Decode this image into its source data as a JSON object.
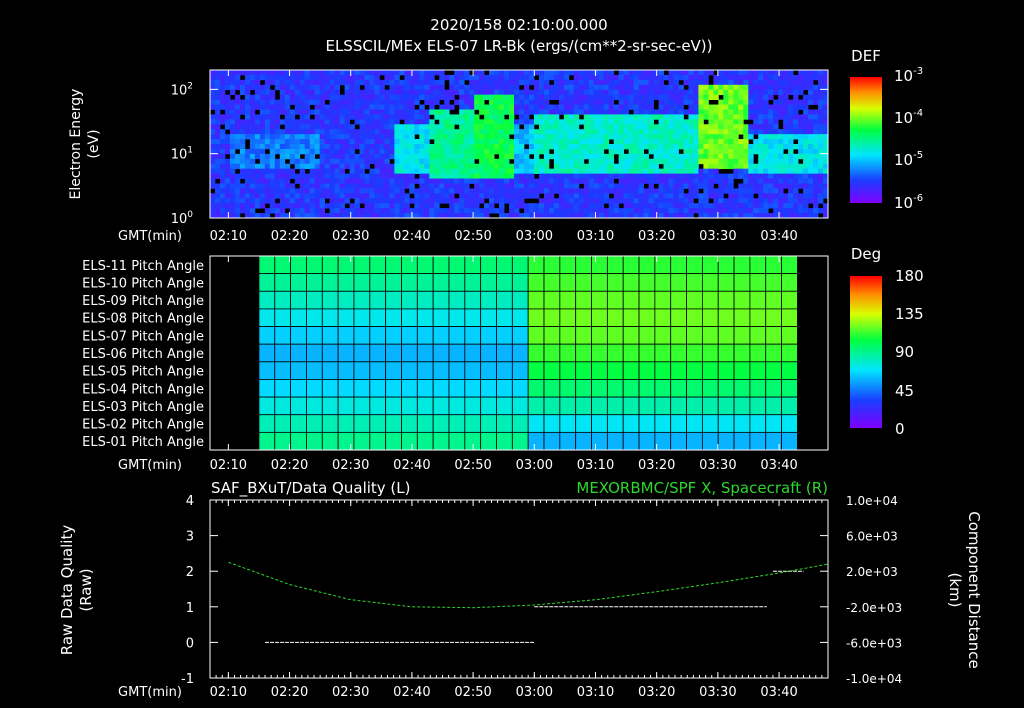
{
  "header": {
    "timestamp": "2020/158 02:10:00.000",
    "subtitle": "ELSSCIL/MEx ELS-07 LR-Bk  (ergs/(cm**2-sr-sec-eV))"
  },
  "colors": {
    "background": "#000000",
    "foreground": "#ffffff",
    "spacecraft_trace": "#2dd62d",
    "data_quality_trace": "#ffffff"
  },
  "chart_data": [
    {
      "type": "heatmap",
      "id": "electron-spectrogram",
      "ylabel": "Electron Energy (eV)",
      "yscale": "log",
      "ylim": [
        1,
        200
      ],
      "y_ticks": [
        "10^0",
        "10^1",
        "10^2"
      ],
      "x_tick_labels": [
        "02:10",
        "02:20",
        "02:30",
        "02:40",
        "02:50",
        "03:00",
        "03:10",
        "03:20",
        "03:30",
        "03:40"
      ],
      "xlabel": "GMT(min)",
      "colorbar": {
        "title": "DEF",
        "scale": "log",
        "labels": [
          "10^-3",
          "10^-4",
          "10^-5",
          "10^-6"
        ],
        "range": [
          1e-06,
          0.001
        ]
      },
      "features": [
        {
          "start": "02:10",
          "end": "02:25",
          "energy_min": 6,
          "energy_max": 20,
          "level": 0.32
        },
        {
          "start": "02:37",
          "end": "02:43",
          "energy_min": 5,
          "energy_max": 30,
          "level": 0.45
        },
        {
          "start": "02:43",
          "end": "02:50",
          "energy_min": 4,
          "energy_max": 50,
          "level": 0.55
        },
        {
          "start": "02:50",
          "end": "02:57",
          "energy_min": 4,
          "energy_max": 90,
          "level": 0.62
        },
        {
          "start": "02:57",
          "end": "03:00",
          "energy_min": 5,
          "energy_max": 30,
          "level": 0.4
        },
        {
          "start": "03:00",
          "end": "03:27",
          "energy_min": 5,
          "energy_max": 40,
          "level": 0.5
        },
        {
          "start": "03:27",
          "end": "03:35",
          "energy_min": 6,
          "energy_max": 120,
          "level": 0.72
        },
        {
          "start": "03:35",
          "end": "03:48",
          "energy_min": 5,
          "energy_max": 20,
          "level": 0.45
        }
      ]
    },
    {
      "type": "heatmap",
      "id": "pitch-angle",
      "rows": [
        "ELS-11 Pitch Angle",
        "ELS-10 Pitch Angle",
        "ELS-09 Pitch Angle",
        "ELS-08 Pitch Angle",
        "ELS-07 Pitch Angle",
        "ELS-06 Pitch Angle",
        "ELS-05 Pitch Angle",
        "ELS-04 Pitch Angle",
        "ELS-03 Pitch Angle",
        "ELS-02 Pitch Angle",
        "ELS-01 Pitch Angle"
      ],
      "x_tick_labels": [
        "02:10",
        "02:20",
        "02:30",
        "02:40",
        "02:50",
        "03:00",
        "03:10",
        "03:20",
        "03:30",
        "03:40"
      ],
      "xlabel": "GMT(min)",
      "data_start": "02:15",
      "data_end": "03:43",
      "columns": 34,
      "colorbar": {
        "title": "Deg",
        "labels": [
          "180",
          "135",
          "90",
          "45",
          "0"
        ],
        "range": [
          0,
          180
        ]
      },
      "rows_before_03_00": [
        95,
        88,
        80,
        72,
        64,
        58,
        60,
        66,
        74,
        82,
        90
      ],
      "rows_after_03_00": [
        110,
        114,
        118,
        120,
        118,
        112,
        104,
        96,
        84,
        70,
        58
      ]
    },
    {
      "type": "line",
      "id": "data-quality-spacecraft",
      "title_left": "SAF_BXuT/Data Quality (L)",
      "title_right": "MEXORBMC/SPF X, Spacecraft (R)",
      "ylabel_left": "Raw Data Quality (Raw)",
      "ylabel_right": "Component Distance (km)",
      "ylim_left": [
        -1,
        4
      ],
      "left_ticks": [
        "4",
        "3",
        "2",
        "1",
        "0",
        "-1"
      ],
      "ylim_right": [
        -10000,
        10000
      ],
      "right_ticks": [
        "1.0e+04",
        "6.0e+03",
        "2.0e+03",
        "-2.0e+03",
        "-6.0e+03",
        "-1.0e+04"
      ],
      "x_tick_labels": [
        "02:10",
        "02:20",
        "02:30",
        "02:40",
        "02:50",
        "03:00",
        "03:10",
        "03:20",
        "03:30",
        "03:40"
      ],
      "xlabel": "GMT(min)",
      "series": [
        {
          "axis": "left",
          "segments": [
            {
              "start": "02:16",
              "end": "03:00",
              "value": 0
            },
            {
              "start": "03:00",
              "end": "03:38",
              "value": 1
            },
            {
              "start": "03:39",
              "end": "03:44",
              "value": 2
            }
          ]
        },
        {
          "axis": "right",
          "x": [
            "02:10",
            "02:20",
            "02:30",
            "02:40",
            "02:50",
            "03:00",
            "03:10",
            "03:20",
            "03:30",
            "03:40",
            "03:48"
          ],
          "values": [
            3000,
            500,
            -1200,
            -2000,
            -2100,
            -1800,
            -1200,
            -300,
            700,
            1800,
            2800
          ]
        }
      ]
    }
  ]
}
